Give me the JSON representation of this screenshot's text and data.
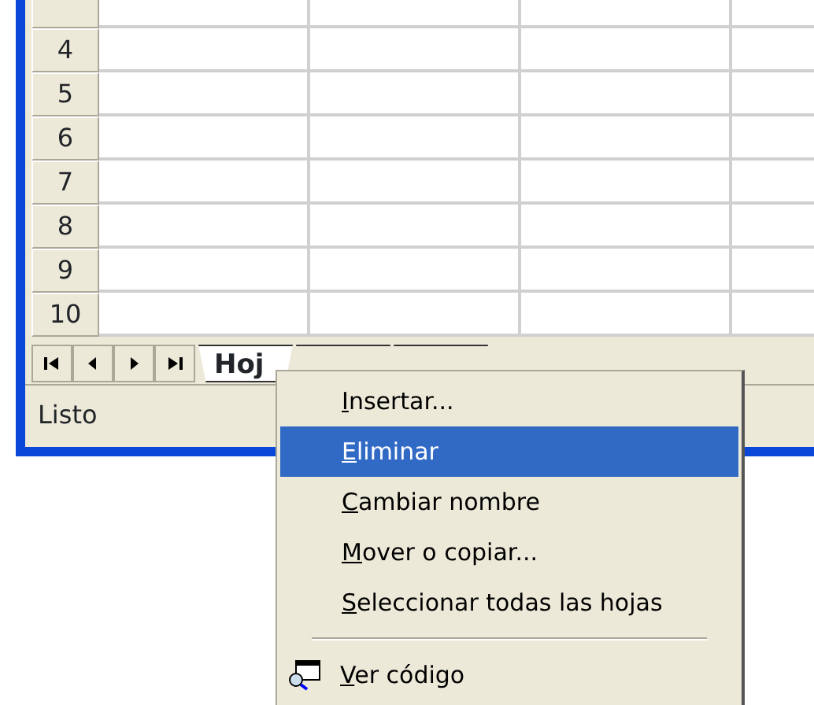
{
  "sheet": {
    "row_headers": [
      "4",
      "5",
      "6",
      "7",
      "8",
      "9",
      "10"
    ]
  },
  "sheet_tabs": [
    {
      "label": "Hoj",
      "selected": true
    },
    {
      "selected": false
    },
    {
      "selected": false
    }
  ],
  "status_bar": {
    "text": "Listo"
  },
  "context_menu": {
    "items": [
      {
        "kind": "item",
        "label": "Insertar...",
        "selected": false
      },
      {
        "kind": "item",
        "label": "Eliminar",
        "selected": true
      },
      {
        "kind": "item",
        "label": "Cambiar nombre",
        "selected": false
      },
      {
        "kind": "item",
        "label": "Mover o copiar...",
        "selected": false
      },
      {
        "kind": "item",
        "label": "Seleccionar todas las hojas",
        "selected": false
      },
      {
        "kind": "separator"
      },
      {
        "kind": "icon-item",
        "label": "Ver código",
        "selected": false
      }
    ]
  }
}
